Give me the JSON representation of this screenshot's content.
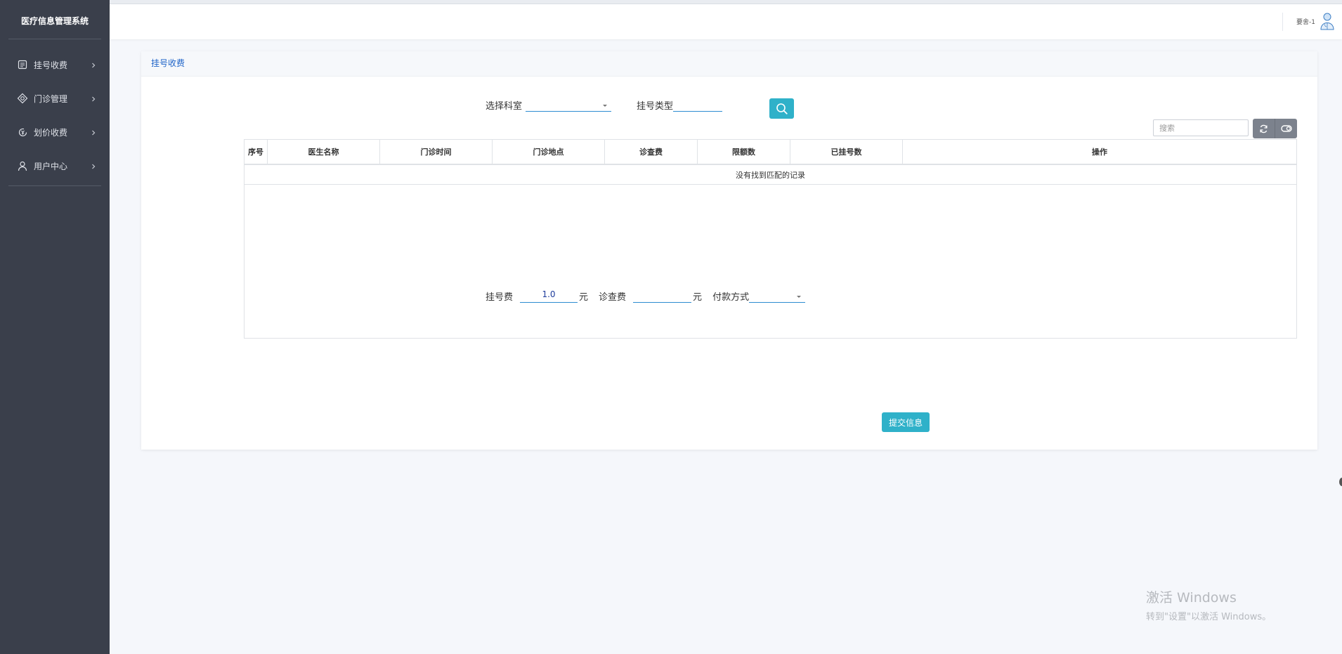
{
  "sidebar": {
    "brand": "医疗信息管理系统",
    "items": [
      {
        "label": "挂号收费",
        "icon": "register-icon"
      },
      {
        "label": "门诊管理",
        "icon": "clinic-icon"
      },
      {
        "label": "划价收费",
        "icon": "pricing-icon"
      },
      {
        "label": "用户中心",
        "icon": "user-icon"
      }
    ]
  },
  "header": {
    "user_name": "要舍-1",
    "avatar_icon": "doctor-avatar-icon"
  },
  "panel": {
    "title": "挂号收费"
  },
  "filters": {
    "department_label": "选择科室",
    "department_value": "",
    "reg_type_label": "挂号类型",
    "reg_type_value": ""
  },
  "table": {
    "search_placeholder": "搜索",
    "columns": [
      "序号",
      "医生名称",
      "门诊时间",
      "门诊地点",
      "诊查费",
      "限额数",
      "已挂号数",
      "操作"
    ],
    "empty_text": "没有找到匹配的记录"
  },
  "fees": {
    "reg_fee_label": "挂号费",
    "reg_fee_value": "1.0",
    "unit": "元",
    "exam_fee_label": "诊查费",
    "exam_fee_value": "",
    "payment_label": "付款方式",
    "payment_value": ""
  },
  "submit_label": "提交信息",
  "watermark": {
    "title": "激活 Windows",
    "subtitle": "转到\"设置\"以激活 Windows。"
  },
  "colors": {
    "sidebar_bg": "#3a3f4b",
    "accent": "#2fb1c9",
    "link": "#1e63c8"
  }
}
